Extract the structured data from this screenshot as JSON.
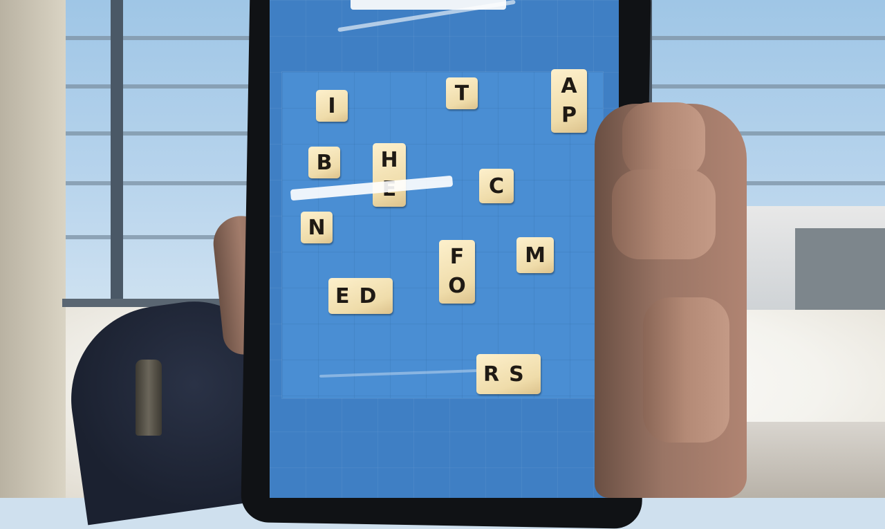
{
  "game": {
    "tiles": [
      {
        "letter": "I"
      },
      {
        "letter": "T"
      },
      {
        "letter": "A"
      },
      {
        "letter": "P"
      },
      {
        "letter": "B"
      },
      {
        "letter": "H"
      },
      {
        "letter": "E"
      },
      {
        "letter": "C"
      },
      {
        "letter": "N"
      },
      {
        "letter": "F"
      },
      {
        "letter": "O"
      },
      {
        "letter": "M"
      },
      {
        "letter": "E"
      },
      {
        "letter": "D"
      },
      {
        "letter": "R"
      },
      {
        "letter": "S"
      }
    ]
  },
  "colors": {
    "board": "#4a8ed3",
    "tile": "#efdcaa",
    "letter": "#1f1a14"
  }
}
